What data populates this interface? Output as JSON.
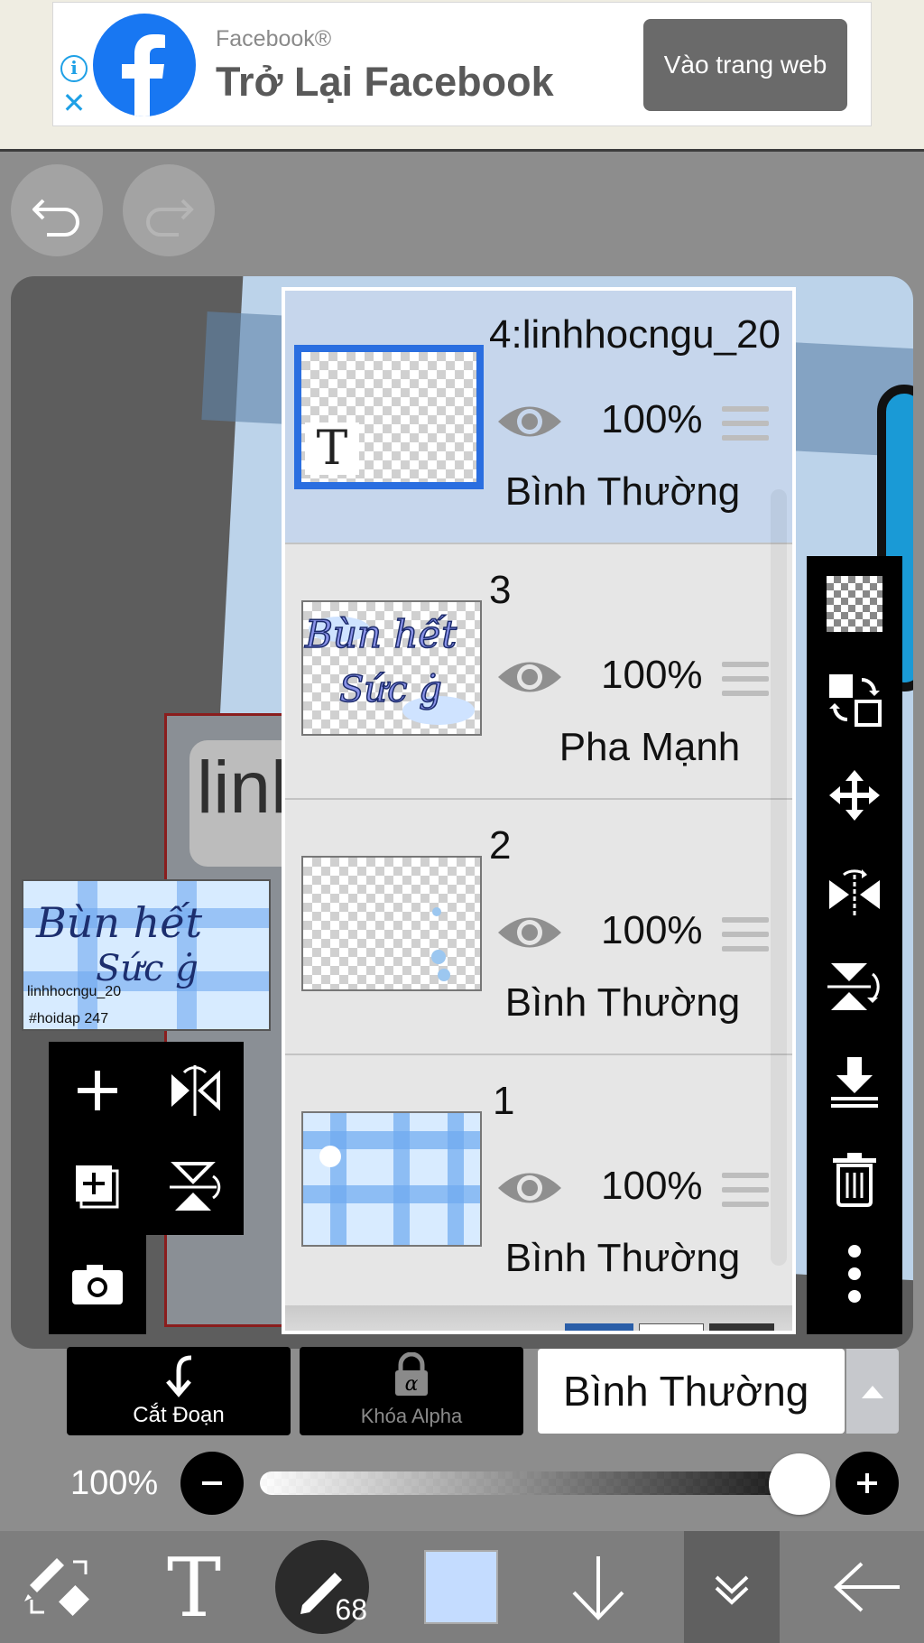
{
  "ad": {
    "brand": "Facebook®",
    "title": "Trở Lại Facebook",
    "cta": "Vào trang web",
    "info_icon": "info-icon",
    "close_icon": "close-icon"
  },
  "history": {
    "undo_icon": "undo-icon",
    "redo_icon": "redo-icon"
  },
  "canvas": {
    "overview_text_1": "linhhocngu_20",
    "overview_text_2": "#hoidap 247",
    "partial_text": "linh"
  },
  "layers": [
    {
      "name": "4:linhhocngu_20",
      "opacity": "100%",
      "blend": "Bình Thường",
      "selected": true,
      "thumb_text": "T"
    },
    {
      "name": "3",
      "opacity": "100%",
      "blend": "Pha Mạnh",
      "selected": false
    },
    {
      "name": "2",
      "opacity": "100%",
      "blend": "Bình Thường",
      "selected": false
    },
    {
      "name": "1",
      "opacity": "100%",
      "blend": "Bình Thường",
      "selected": false
    }
  ],
  "left_tools": [
    "add-layer-icon",
    "flip-horizontal-icon",
    "duplicate-layer-icon",
    "flip-vertical-icon",
    "camera-icon"
  ],
  "right_tools": [
    "transparency-icon",
    "layer-transform-icon",
    "move-icon",
    "flip-horizontal-icon",
    "flip-vertical-icon",
    "merge-down-icon",
    "delete-icon",
    "more-icon"
  ],
  "controls": {
    "clip_label": "Cắt Đoạn",
    "alpha_lock_label": "Khóa Alpha",
    "blend_mode": "Bình Thường",
    "opacity": "100%",
    "opacity_value": 1.0
  },
  "toolbar": {
    "brush_size": "68",
    "color": "#c4dcff",
    "tools": [
      "select-transform-icon",
      "text-tool-icon",
      "brush-icon",
      "color-swatch",
      "down-arrow-icon",
      "layers-collapse-icon",
      "back-arrow-icon"
    ]
  }
}
